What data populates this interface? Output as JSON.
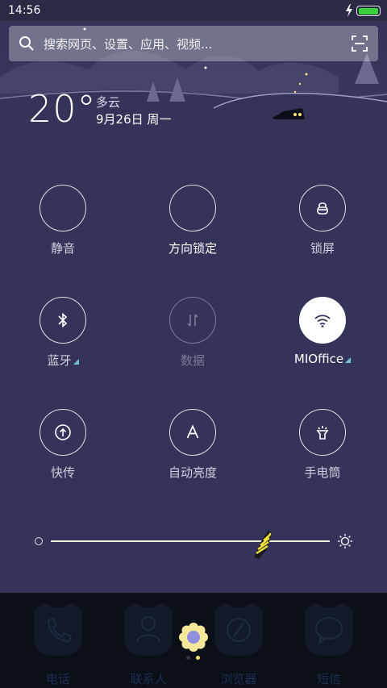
{
  "status": {
    "time": "14:56",
    "battery_level": 1.0
  },
  "search": {
    "placeholder": "搜索网页、设置、应用、视频..."
  },
  "weather": {
    "temp": "20°",
    "condition": "多云",
    "date": "9月26日 周一"
  },
  "toggles": [
    {
      "label": "静音",
      "icon": "bell-off-icon",
      "state": "on"
    },
    {
      "label": "方向锁定",
      "icon": "rotation-lock-icon",
      "state": "on"
    },
    {
      "label": "锁屏",
      "icon": "lock-icon",
      "state": "off"
    },
    {
      "label": "蓝牙",
      "icon": "bluetooth-icon",
      "state": "off",
      "has_more": true
    },
    {
      "label": "数据",
      "icon": "data-arrows-icon",
      "state": "disabled"
    },
    {
      "label": "MIOffice",
      "icon": "wifi-icon",
      "state": "on",
      "has_more": true
    },
    {
      "label": "快传",
      "icon": "share-upload-icon",
      "state": "off"
    },
    {
      "label": "自动亮度",
      "icon": "auto-brightness-icon",
      "state": "off"
    },
    {
      "label": "手电筒",
      "icon": "flashlight-icon",
      "state": "off"
    }
  ],
  "brightness": {
    "level": 0.76
  },
  "dock": [
    {
      "label": "电话",
      "icon": "phone-icon"
    },
    {
      "label": "联系人",
      "icon": "contacts-icon"
    },
    {
      "label": "浏览器",
      "icon": "browser-icon"
    },
    {
      "label": "短信",
      "icon": "message-icon"
    }
  ],
  "pager": {
    "pages": 2,
    "current": 2
  },
  "colors": {
    "background": "#34345a",
    "accent_on": "#ffffff",
    "battery": "#39d13a",
    "more_indicator": "#6fc3dd"
  }
}
